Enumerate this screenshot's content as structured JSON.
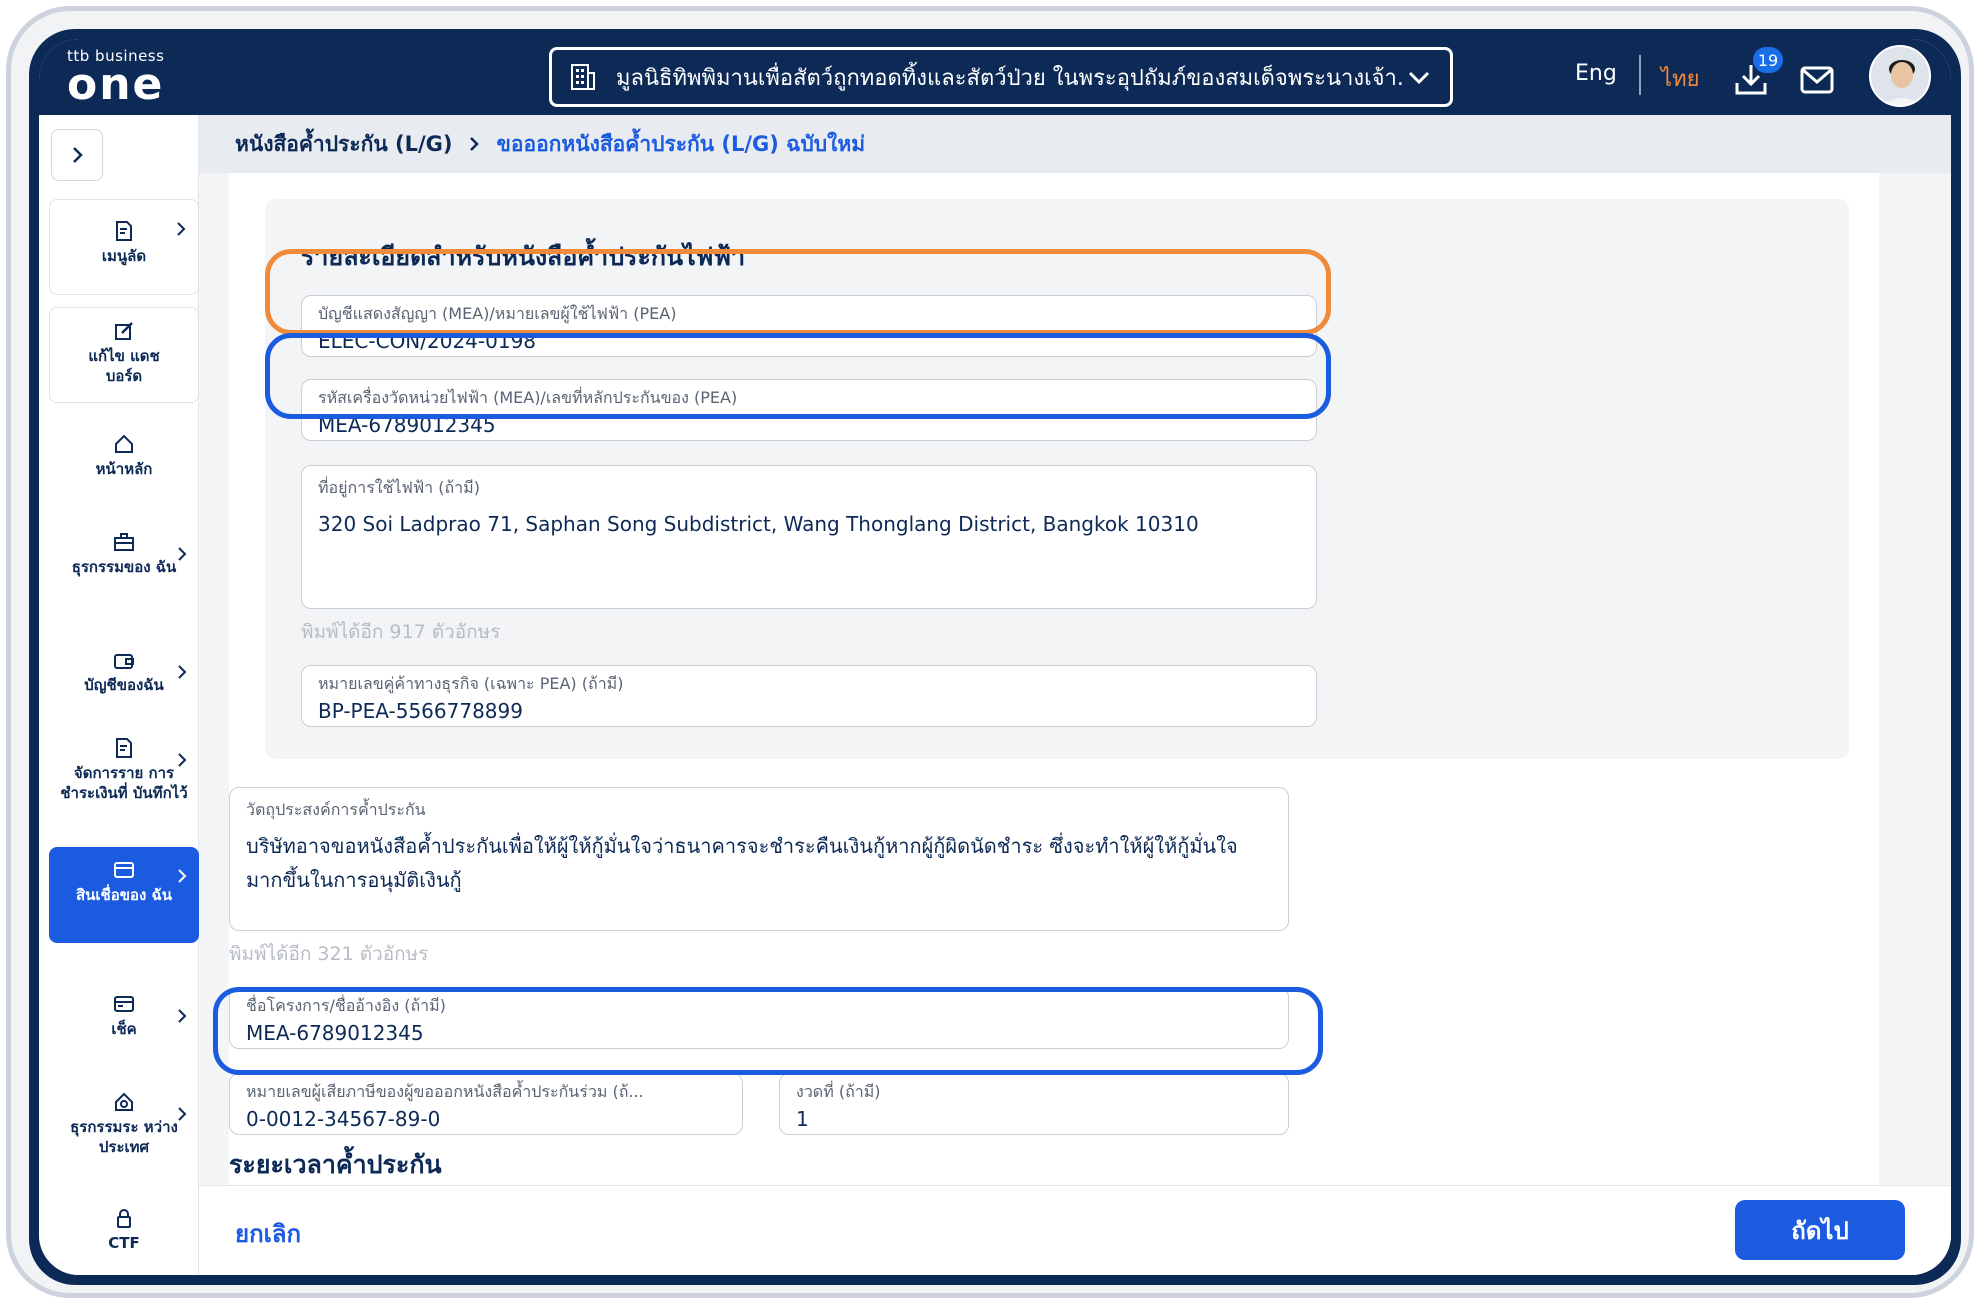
{
  "brand": {
    "small": "ttb business",
    "big": "one"
  },
  "header": {
    "organization": "มูลนิธิทิพพิมานเพื่อสัตว์ถูกทอดทิ้งและสัตว์ป่วย ในพระอุปถัมภ์ของสมเด็จพระนางเจ้า...",
    "lang_en": "Eng",
    "lang_th": "ไทย",
    "download_badge": "19"
  },
  "sidebar": {
    "items": [
      {
        "label": "เมนูลัด",
        "icon": "document-icon"
      },
      {
        "label": "แก้ไข แดชบอร์ด",
        "icon": "edit-icon"
      },
      {
        "label": "หน้าหลัก",
        "icon": "home-icon"
      },
      {
        "label": "ธุรกรรมของ ฉัน",
        "icon": "briefcase-icon"
      },
      {
        "label": "บัญชีของฉัน",
        "icon": "wallet-icon"
      },
      {
        "label": "จัดการราย การชำระเงินที่ บันทึกไว้",
        "icon": "document-icon"
      },
      {
        "label": "สินเชื่อของ ฉัน",
        "icon": "card-icon"
      },
      {
        "label": "เช็ค",
        "icon": "cheque-icon"
      },
      {
        "label": "ธุรกรรมระ หว่างประเทศ",
        "icon": "global-icon"
      },
      {
        "label": "CTF",
        "icon": "lock-icon"
      }
    ]
  },
  "breadcrumb": {
    "parent": "หนังสือค้ำประกัน (L/G)",
    "current": "ขอออกหนังสือค้ำประกัน (L/G) ฉบับใหม่"
  },
  "section": {
    "title": "รายละเอียดสำหรับหนังสือค้ำประกันไฟฟ้า",
    "fields": {
      "contract": {
        "label": "บัญชีแสดงสัญญา (MEA)/หมายเลขผู้ใช้ไฟฟ้า (PEA)",
        "value": "ELEC-CON/2024-0198"
      },
      "meter": {
        "label": "รหัสเครื่องวัดหน่วยไฟฟ้า (MEA)/เลขที่หลักประกันของ (PEA)",
        "value": "MEA-6789012345"
      },
      "address": {
        "label": "ที่อยู่การใช้ไฟฟ้า (ถ้ามี)",
        "value": "320 Soi Ladprao 71, Saphan Song Subdistrict, Wang Thonglang District, Bangkok 10310",
        "helper": "พิมพ์ได้อีก 917 ตัวอักษร"
      },
      "bp": {
        "label": "หมายเลขคู่ค้าทางธุรกิจ (เฉพาะ PEA) (ถ้ามี)",
        "value": "BP-PEA-5566778899"
      }
    }
  },
  "purpose": {
    "label": "วัตถุประสงค์การค้ำประกัน",
    "value": "บริษัทอาจขอหนังสือค้ำประกันเพื่อให้ผู้ให้กู้มั่นใจว่าธนาคารจะชำระคืนเงินกู้หากผู้กู้ผิดนัดชำระ ซึ่งจะทำให้ผู้ให้กู้มั่นใจมากขึ้นในการอนุมัติเงินกู้",
    "helper": "พิมพ์ได้อีก 321 ตัวอักษร"
  },
  "project": {
    "label": "ชื่อโครงการ/ชื่ออ้างอิง (ถ้ามี)",
    "value": "MEA-6789012345"
  },
  "tax_id": {
    "label": "หมายเลขผู้เสียภาษีของผู้ขอออกหนังสือค้ำประกันร่วม (ถ้...",
    "value": "0-0012-34567-89-0"
  },
  "installment": {
    "label": "งวดที่ (ถ้ามี)",
    "value": "1"
  },
  "period_title": "ระยะเวลาค้ำประกัน",
  "footer": {
    "cancel": "ยกเลิก",
    "next": "ถัดไป"
  }
}
